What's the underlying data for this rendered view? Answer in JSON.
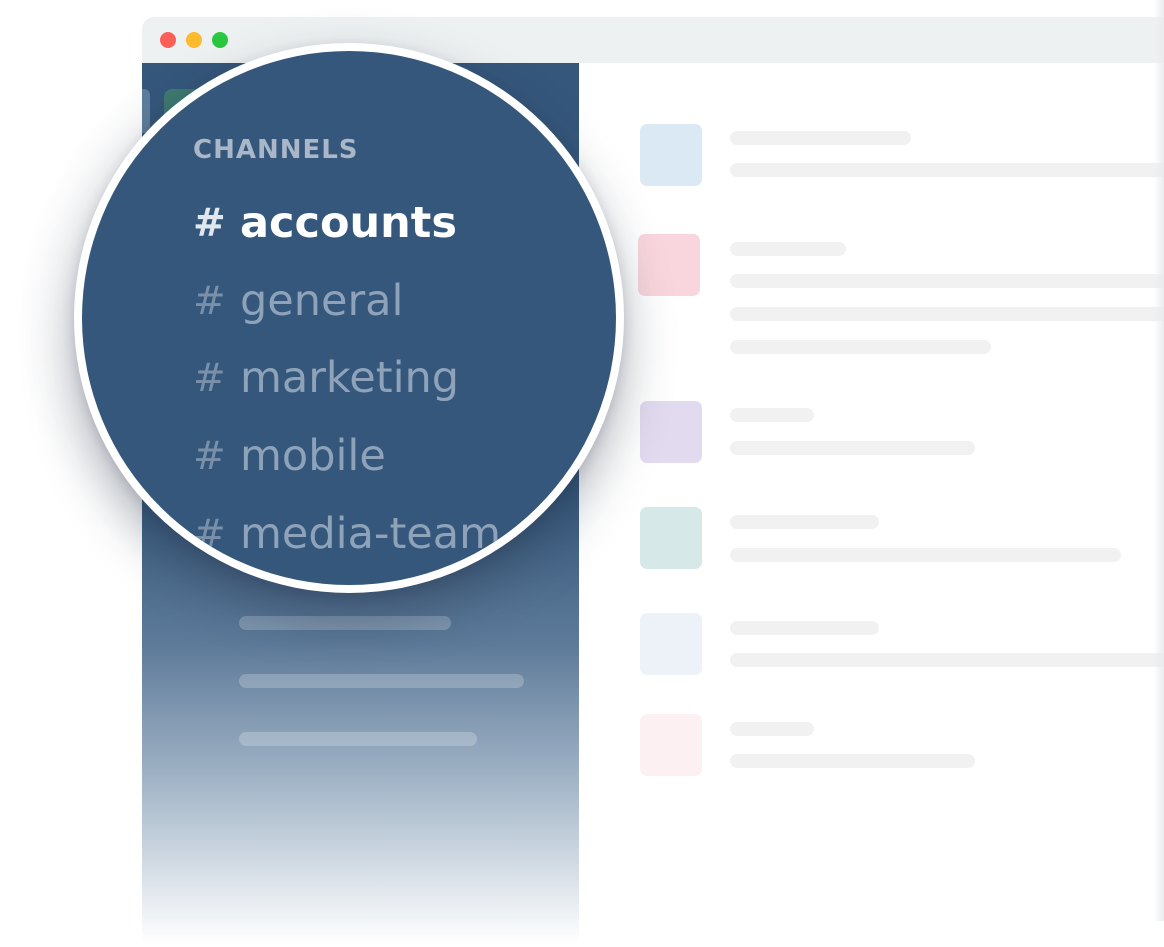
{
  "window": {
    "traffic_lights": [
      {
        "name": "close",
        "color": "#fb5f57"
      },
      {
        "name": "minimize",
        "color": "#fcba2f"
      },
      {
        "name": "maximize",
        "color": "#29c840"
      }
    ]
  },
  "colors": {
    "sidebar": "#35577b",
    "active_channel_text": "#ffffff",
    "inactive_channel_text": "#8ea2ba",
    "section_header_text": "#aab7c8"
  },
  "sidebar": {
    "section_title": "CHANNELS",
    "hash_symbol": "#",
    "channels": [
      {
        "name": "accounts",
        "active": true
      },
      {
        "name": "general",
        "active": false
      },
      {
        "name": "marketing",
        "active": false
      },
      {
        "name": "mobile",
        "active": false
      },
      {
        "name": "media-team",
        "active": false
      }
    ]
  },
  "messages": {
    "avatar_colors": [
      "#dbe9f4",
      "#f9d6dd",
      "#e2dbf0",
      "#d6e9e8",
      "#edf2f8",
      "#fdf0f2"
    ]
  }
}
